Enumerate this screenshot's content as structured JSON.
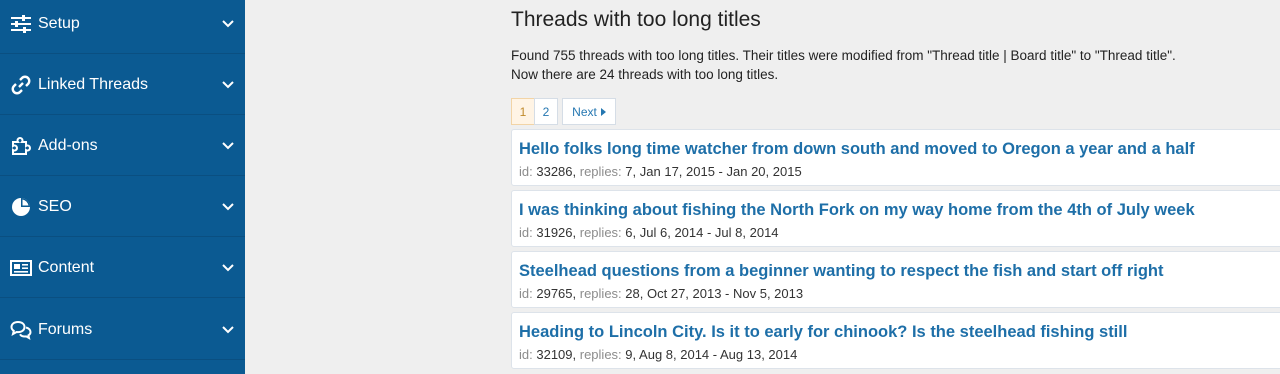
{
  "sidebar": {
    "items": [
      {
        "label": "Setup",
        "icon": "sliders-icon"
      },
      {
        "label": "Linked Threads",
        "icon": "link-icon"
      },
      {
        "label": "Add-ons",
        "icon": "puzzle-icon"
      },
      {
        "label": "SEO",
        "icon": "pie-chart-icon"
      },
      {
        "label": "Content",
        "icon": "newspaper-icon"
      },
      {
        "label": "Forums",
        "icon": "comments-icon"
      }
    ]
  },
  "main": {
    "title": "Threads with too long titles",
    "description_line1": "Found 755 threads with too long titles. Their titles were modified from \"Thread title | Board title\" to \"Thread title\".",
    "description_line2": "Now there are 24 threads with too long titles.",
    "pagination": {
      "pages": [
        "1",
        "2"
      ],
      "current": "1",
      "next_label": "Next"
    },
    "threads": [
      {
        "title": "Hello folks long time watcher from down south and moved to Oregon a year and a half",
        "id": "33286",
        "replies": "7",
        "dates": "Jan 17, 2015 - Jan 20, 2015"
      },
      {
        "title": "I was thinking about fishing the North Fork on my way home from the 4th of July week",
        "id": "31926",
        "replies": "6",
        "dates": "Jul 6, 2014 - Jul 8, 2014"
      },
      {
        "title": "Steelhead questions from a beginner wanting to respect the fish and start off right",
        "id": "29765",
        "replies": "28",
        "dates": "Oct 27, 2013 - Nov 5, 2013"
      },
      {
        "title": "Heading to Lincoln City. Is it to early for chinook? Is the steelhead fishing still",
        "id": "32109",
        "replies": "9",
        "dates": "Aug 8, 2014 - Aug 13, 2014"
      }
    ],
    "meta_labels": {
      "id": "id:",
      "replies": "replies:"
    }
  }
}
